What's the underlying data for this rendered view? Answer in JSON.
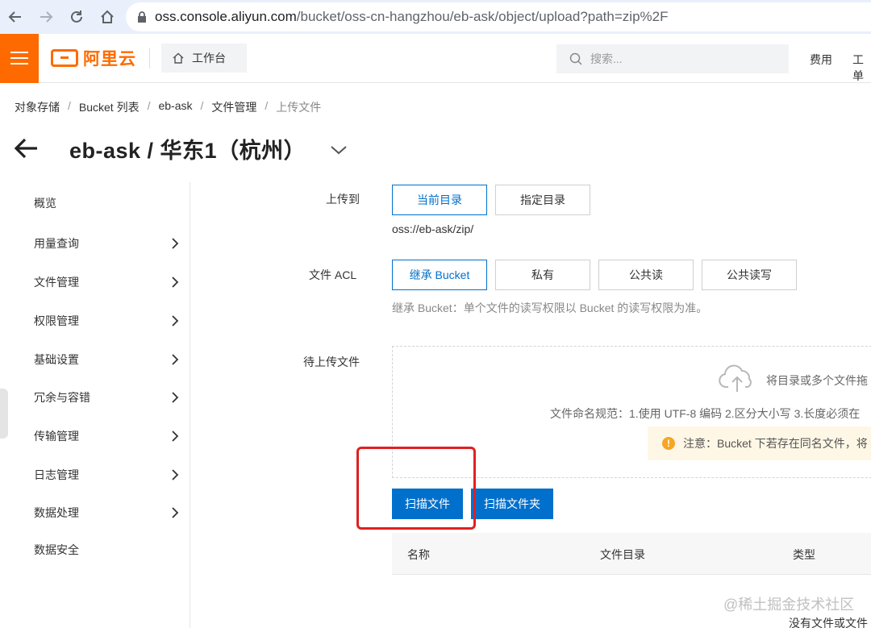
{
  "browser": {
    "url_host": "oss.console.aliyun.com",
    "url_path": "/bucket/oss-cn-hangzhou/eb-ask/object/upload?path=zip%2F"
  },
  "header": {
    "logo_text": "阿里云",
    "workbench_label": "工作台",
    "search_placeholder": "搜索...",
    "link_fees": "费用",
    "link_tickets": "工单"
  },
  "breadcrumb": {
    "items": [
      "对象存储",
      "Bucket 列表",
      "eb-ask",
      "文件管理"
    ],
    "current": "上传文件",
    "separator": "/"
  },
  "page": {
    "title": "eb-ask / 华东1（杭州）"
  },
  "sidebar": {
    "items": [
      {
        "label": "概览",
        "expandable": false
      },
      {
        "label": "用量查询",
        "expandable": true
      },
      {
        "label": "文件管理",
        "expandable": true
      },
      {
        "label": "权限管理",
        "expandable": true
      },
      {
        "label": "基础设置",
        "expandable": true
      },
      {
        "label": "冗余与容错",
        "expandable": true
      },
      {
        "label": "传输管理",
        "expandable": true
      },
      {
        "label": "日志管理",
        "expandable": true
      },
      {
        "label": "数据处理",
        "expandable": true
      },
      {
        "label": "数据安全",
        "expandable": false
      }
    ]
  },
  "form": {
    "upload_to_label": "上传到",
    "upload_to_options": [
      "当前目录",
      "指定目录"
    ],
    "upload_to_selected": "当前目录",
    "current_path": "oss://eb-ask/zip/",
    "acl_label": "文件 ACL",
    "acl_options": [
      "继承 Bucket",
      "私有",
      "公共读",
      "公共读写"
    ],
    "acl_selected": "继承 Bucket",
    "acl_hint": "继承 Bucket：单个文件的读写权限以 Bucket 的读写权限为准。",
    "pending_label": "待上传文件",
    "drop_text": "将目录或多个文件拖",
    "naming_rule": "文件命名规范：1.使用 UTF-8 编码 2.区分大小写 3.长度必须在",
    "notice": "注意：Bucket 下若存在同名文件，将",
    "scan_files_button": "扫描文件",
    "scan_folder_button": "扫描文件夹"
  },
  "table": {
    "columns": [
      "名称",
      "文件目录",
      "类型"
    ],
    "empty_text": "没有文件或文件"
  },
  "watermark": "@稀土掘金技术社区",
  "colors": {
    "brand_orange": "#ff6a00",
    "primary_blue": "#0070cc",
    "highlight_red": "#e02020"
  }
}
